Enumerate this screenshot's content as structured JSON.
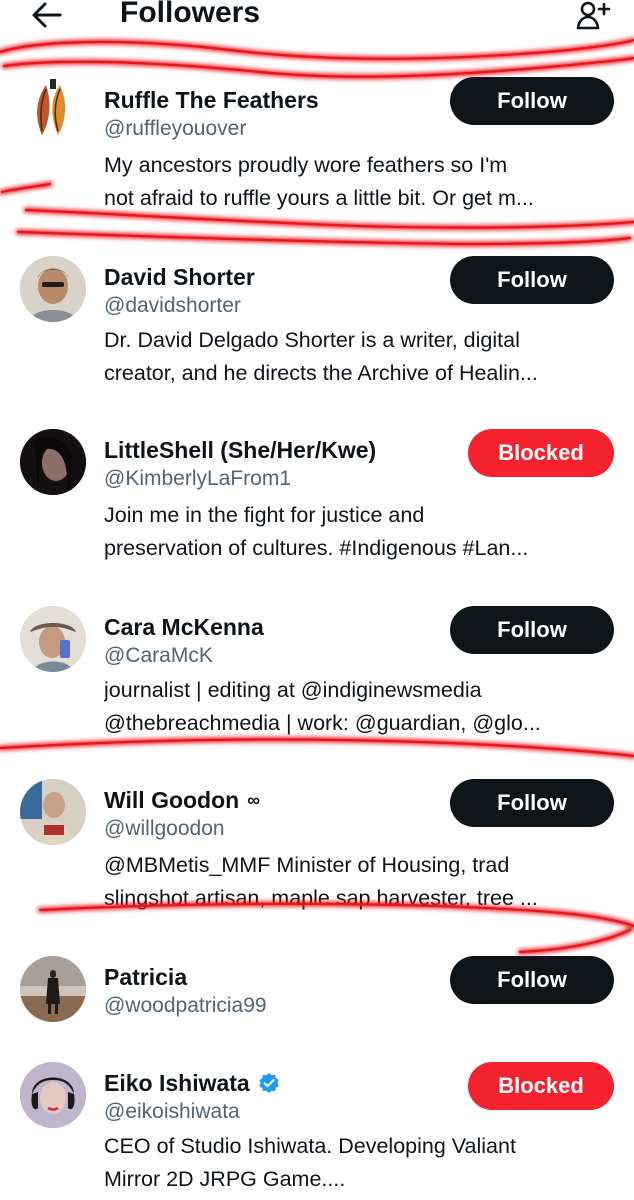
{
  "header": {
    "title": "Followers",
    "back_icon": "arrow-left-icon",
    "add_icon": "add-user-icon"
  },
  "colors": {
    "follow_button": "#0f1419",
    "blocked_button": "#f4212e",
    "secondary_text": "#536471",
    "verified": "#1d9bf0",
    "annotation": "#e8141e"
  },
  "users": [
    {
      "name": "Ruffle The Feathers",
      "handle": "@ruffleyouover",
      "bio": [
        "My ancestors proudly wore feathers so I'm",
        "not afraid to ruffle yours a little bit. Or get m..."
      ],
      "button": "Follow"
    },
    {
      "name": "David Shorter",
      "handle": "@davidshorter",
      "bio": [
        "Dr. David Delgado Shorter is a writer, digital",
        "creator, and he directs the Archive of Healin..."
      ],
      "button": "Follow"
    },
    {
      "name": "LittleShell (She/Her/Kwe)",
      "handle": "@KimberlyLaFrom1",
      "bio": [
        "Join me in the fight for justice and",
        "preservation of cultures. #Indigenous #Lan..."
      ],
      "button": "Blocked"
    },
    {
      "name": "Cara McKenna",
      "handle": "@CaraMcK",
      "bio": [
        "journalist | editing at @indiginewsmedia",
        "@thebreachmedia | work: @guardian, @glo..."
      ],
      "button": "Follow"
    },
    {
      "name": "Will Goodon",
      "name_suffix": "∞",
      "handle": "@willgoodon",
      "bio": [
        "@MBMetis_MMF Minister of Housing, trad",
        "slingshot artisan, maple sap harvester, tree ..."
      ],
      "button": "Follow"
    },
    {
      "name": "Patricia",
      "handle": "@woodpatricia99",
      "bio": [],
      "button": "Follow"
    },
    {
      "name": "Eiko Ishiwata",
      "verified": true,
      "handle": "@eikoishiwata",
      "bio": [
        "CEO of Studio Ishiwata. Developing Valiant",
        "Mirror 2D JRPG Game...."
      ],
      "button": "Blocked"
    }
  ]
}
